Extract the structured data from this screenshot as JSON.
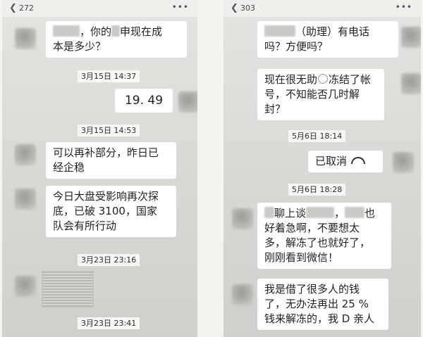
{
  "left": {
    "header": {
      "back_icon": "chevron-left",
      "count": "272",
      "more_icon": "more-dots"
    },
    "messages": {
      "m1_a": "，你的",
      "m1_b": "申现在成",
      "m1_c": "本是多少？",
      "t1": "3月15日 14:37",
      "m2": "19. 49",
      "t2": "3月15日 14:53",
      "m3_a": "可以再补部分，昨日已",
      "m3_b": "经企稳",
      "m4_a": "今日大盘受影响再次探",
      "m4_b": "底，已破 3100，国家",
      "m4_c": "队会有所行动",
      "t3": "3月23日 23:16",
      "t4": "3月23日 23:41"
    }
  },
  "right": {
    "header": {
      "back_icon": "chevron-left",
      "count": "303",
      "more_icon": "more-dots"
    },
    "messages": {
      "m1_a": "（助理）有电话",
      "m1_b": "吗？方便吗？",
      "m2_a": "现在很无助",
      "m2_b": "冻结了帐",
      "m2_c": "号，不知能否几时解",
      "m2_d": "封？",
      "t1": "5月6日 18:14",
      "m3": "已取消",
      "t2": "5月6日 18:28",
      "m4_a": "聊上谈",
      "m4_b": "，",
      "m4_c": "也",
      "m4_d": "好着急啊，不要想太",
      "m4_e": "多，解冻了也就好了，",
      "m4_f": "刚刚看到微信！",
      "m5_a": "我是借了很多人的钱",
      "m5_b": "了，无办法再出 25 %",
      "m5_c": "钱来解冻的，我 D 亲人"
    }
  },
  "colors": {
    "bubble": "#ffffff",
    "background": "#dadad8",
    "time_bg": "#f7f7f5"
  }
}
